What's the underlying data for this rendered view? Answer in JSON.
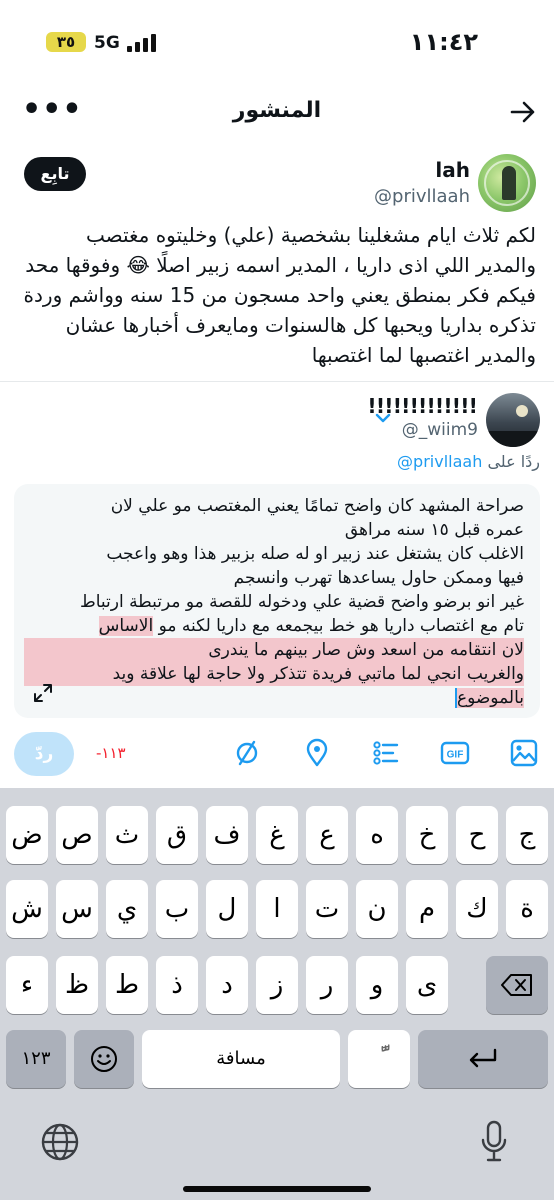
{
  "status_bar": {
    "time": "١١:٤٢",
    "battery": "٣٥",
    "network": "5G"
  },
  "header": {
    "title": "المنشور",
    "more_label": "•••"
  },
  "post": {
    "author_name": "lah",
    "author_handle": "@privllaah",
    "follow_label": "تابِع",
    "text_lines": [
      "لكم ثلاث ايام مشغلينا بشخصية (علي) وخليتوه مغتصب",
      "والمدير اللي اذى داريا ، المدير اسمه زبير اصلًا 😂 وفوقها محد",
      "فيكم فكر بمنطق يعني واحد مسجون من 15 سنه وواشم وردة",
      "تذكره بداريا ويحبها كل هالسنوات ومايعرف أخبارها عشان",
      "والمدير اغتصبها لما اغتصبها"
    ]
  },
  "reply": {
    "user_name": "ǃǃǃǃǃǃǃǃǃǃǃǃǃ",
    "user_handle": "@_wiim9",
    "replying_prefix": "ردًا على",
    "replying_to": "@privllaah"
  },
  "compose": {
    "lines": [
      "صراحة المشهد كان واضح تمامًا يعني المغتصب مو علي لان",
      "عمره قبل ١٥ سنه مراهق",
      "الاغلب كان يشتغل عند زبير او له صله بزبير هذا وهو واعجب",
      "فيها وممكن حاول يساعدها تهرب وانسجم",
      "غير انو برضو واضح قضية علي ودخوله للقصة مو مرتبطة ارتباط",
      "تام مع اغتصاب داريا هو خط بيجمعه مع داريا لكنه مو"
    ],
    "line6_highlight": "الاساس",
    "highlighted_lines": [
      "لان انتقامه من اسعد وش صار بينهم ما يندرى",
      "والغريب انجي لما ماتبي فريدة تتذكر ولا حاجة لها علاقة ويد",
      "بالموضوع"
    ]
  },
  "toolbar": {
    "reply_label": "ردّ",
    "char_count": "-١١٣"
  },
  "keyboard": {
    "row1": [
      "ج",
      "ح",
      "خ",
      "ه",
      "ع",
      "غ",
      "ف",
      "ق",
      "ث",
      "ص",
      "ض"
    ],
    "row2": [
      "ة",
      "ك",
      "م",
      "ن",
      "ت",
      "ا",
      "ل",
      "ب",
      "ي",
      "س",
      "ش"
    ],
    "row3": [
      "ى",
      "و",
      "ر",
      "ز",
      "د",
      "ذ",
      "ط",
      "ظ",
      "ء"
    ],
    "numbers_label": "١٢٣",
    "space_label": "مسافة",
    "diacritic_label": "ًّ"
  },
  "colors": {
    "accent": "#1d9bf0",
    "highlight": "#f3c6cc",
    "counter_red": "#f4212e",
    "keyboard_bg": "#d2d5db"
  }
}
